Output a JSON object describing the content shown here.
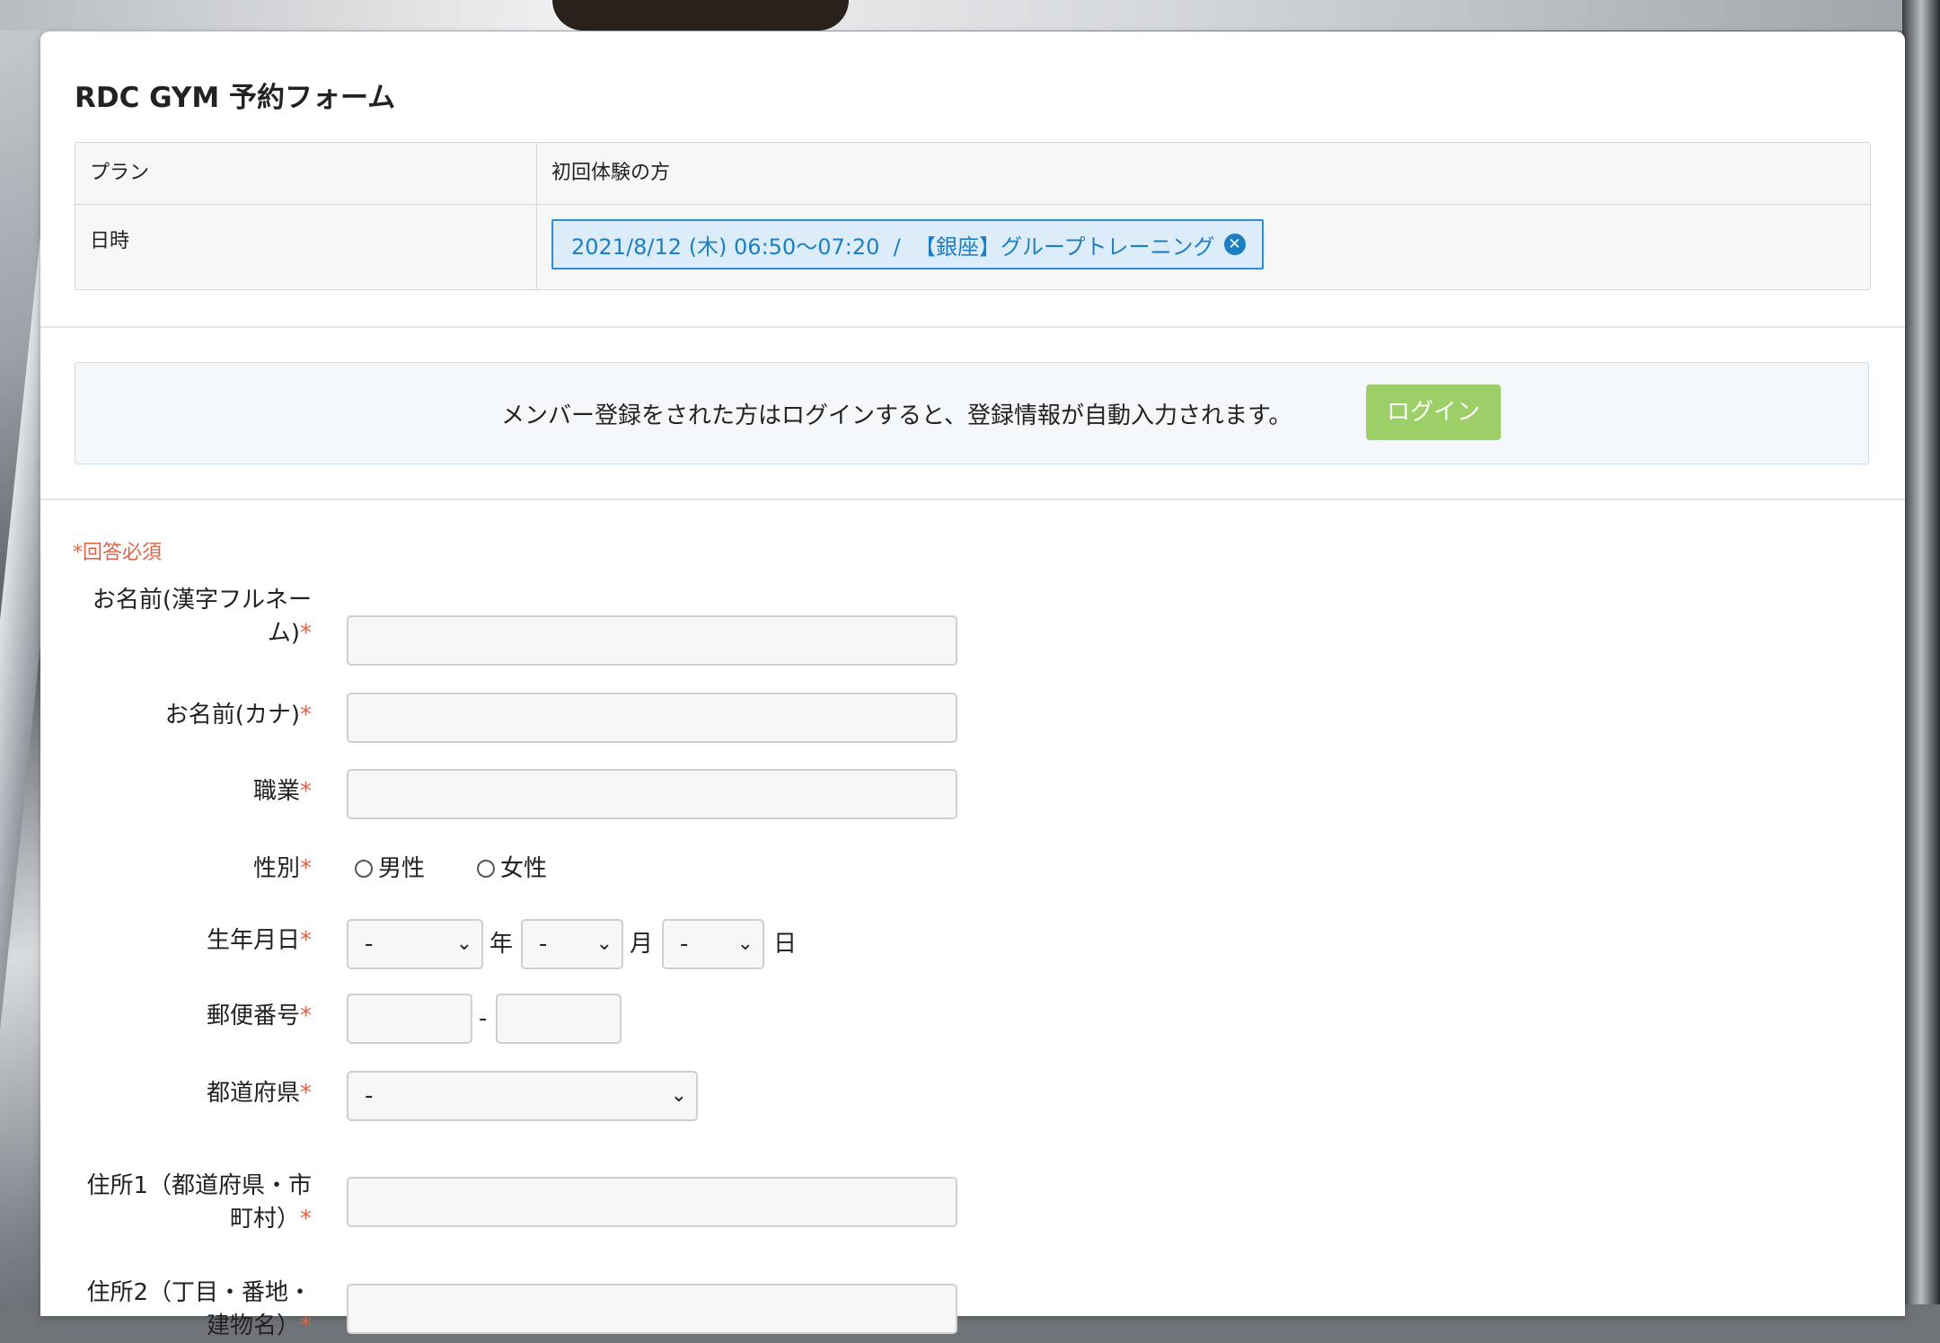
{
  "form": {
    "title": "RDC GYM 予約フォーム",
    "summary": {
      "plan_label": "プラン",
      "plan_value": "初回体験の方",
      "datetime_label": "日時",
      "reservation_chip": "2021/8/12 (木) 06:50〜07:20  /  【銀座】グループトレーニング"
    },
    "login": {
      "message": "メンバー登録をされた方はログインすると、登録情報が自動入力されます。",
      "button": "ログイン"
    },
    "required_note": "*回答必須",
    "required_mark": "*",
    "fields": {
      "name_kanji_label_1": "お名前(漢字フルネー",
      "name_kanji_label_2": "ム)",
      "name_kana_label": "お名前(カナ)",
      "occupation_label": "職業",
      "gender_label": "性別",
      "gender_male": "男性",
      "gender_female": "女性",
      "birthdate_label": "生年月日",
      "birth_year_value": "-",
      "birth_month_value": "-",
      "birth_day_value": "-",
      "year_unit": "年",
      "month_unit": "月",
      "day_unit": "日",
      "postal_label": "郵便番号",
      "postal_separator": "-",
      "prefecture_label": "都道府県",
      "prefecture_value": "-",
      "address1_label_1": "住所1（都道府県・市",
      "address1_label_2": "町村）",
      "address2_label_1": "住所2（丁目・番地・",
      "address2_label_2": "建物名）"
    }
  },
  "colors": {
    "required": "#d9664b",
    "login_button": "#9ccf67",
    "chip_border": "#2a8fd6"
  }
}
